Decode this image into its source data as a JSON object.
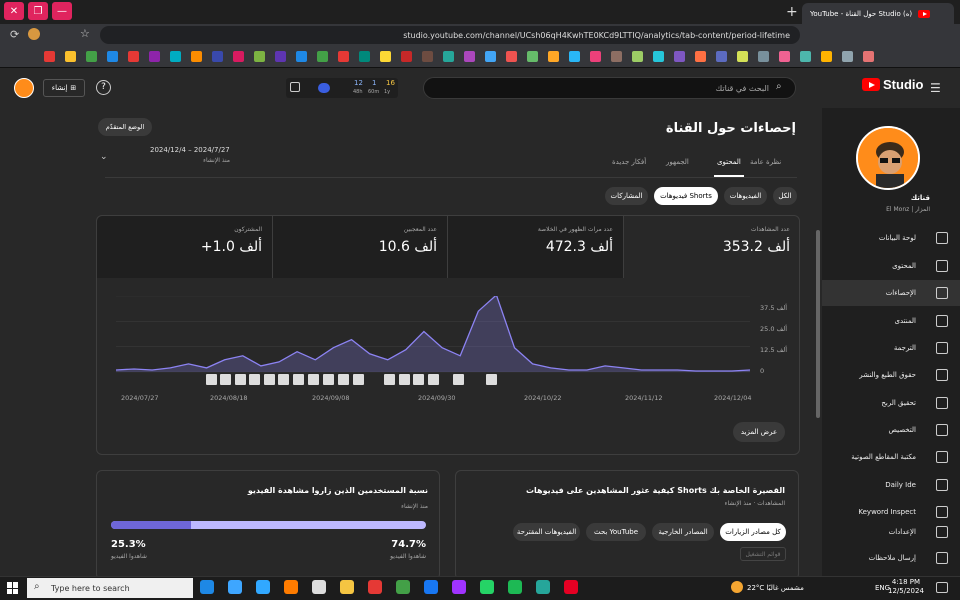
{
  "browser": {
    "tab_title": "(ه) Studio حول القناة - YouTube",
    "new_tab": "+",
    "minimize": "—",
    "restore": "❐",
    "url": "studio.youtube.com/channel/UCsh06qH4KwhTE0KCd9LTTIQ/analytics/tab-content/period-lifetime"
  },
  "header": {
    "search_placeholder": "البحث في قناتك",
    "logo_text": "Studio",
    "create_label": "إنشاء",
    "stats": [
      "12",
      "1",
      "16"
    ],
    "stats_sub": [
      "48h",
      "60m",
      "1y"
    ]
  },
  "sidebar": {
    "channel_name": "قناتك",
    "channel_handle": "El Monz | المزار",
    "items": [
      {
        "label": "لوحة البيانات"
      },
      {
        "label": "المحتوى"
      },
      {
        "label": "الإحصاءات"
      },
      {
        "label": "المنتدى"
      },
      {
        "label": "الترجمة"
      },
      {
        "label": "حقوق الطبع والنشر"
      },
      {
        "label": "تحقيق الربح"
      },
      {
        "label": "التخصيص"
      },
      {
        "label": "مكتبة المقاطع الصوتية"
      },
      {
        "label": "Daily Ide"
      },
      {
        "label": "Keyword Inspect"
      },
      {
        "label": "الإعدادات"
      },
      {
        "label": "إرسال ملاحظات"
      }
    ]
  },
  "main": {
    "title": "إحصاءات حول القناة",
    "advanced": "الوضع المتقدّم",
    "date_range": "2024/12/4 – 2024/7/27",
    "date_sub": "منذ الإنشاء",
    "tabs": [
      "نظرة عامة",
      "المحتوى",
      "الجمهور",
      "أفكار جديدة"
    ],
    "chips": [
      "الكل",
      "الفيديوهات",
      "فيديوهات Shorts",
      "المشاركات"
    ],
    "show_more": "عرض المزيد"
  },
  "stats": [
    {
      "label": "عدد المشاهدات",
      "value": "353.2 ألف"
    },
    {
      "label": "عدد مرات الظهور في الخلاصة",
      "value": "472.3 ألف"
    },
    {
      "label": "عدد المعجبين",
      "value": "10.6 ألف"
    },
    {
      "label": "المشتركون",
      "value": "+1.0 ألف"
    }
  ],
  "chart_data": {
    "type": "line",
    "x": [
      "2024/07/27",
      "2024/08/18",
      "2024/09/08",
      "2024/09/30",
      "2024/10/22",
      "2024/11/12",
      "2024/12/04"
    ],
    "y_ticks": [
      "37.5 ألف",
      "25.0 ألف",
      "12.5 ألف",
      "0"
    ],
    "ylim": [
      0,
      37.5
    ],
    "values": [
      1,
      1.5,
      1,
      2,
      4,
      2,
      6,
      8,
      3,
      5,
      10,
      6,
      12,
      16,
      9,
      6,
      11,
      20,
      12,
      8,
      30,
      38,
      12,
      4,
      2,
      1,
      1,
      3,
      2,
      1,
      1,
      1,
      0.5,
      0.5,
      0.5,
      1
    ],
    "color": "#8c83f3"
  },
  "card_traffic": {
    "title": "كيفية عثور المشاهدين على فيديوهات Shorts القصيرة الخاصة بك",
    "subtitle": "المشاهدات · منذ الإنشاء",
    "chips": [
      "كل مصادر الزيارات",
      "المصادر الخارجية",
      "بحث YouTube",
      "الفيديوهات المقترحة"
    ],
    "bottom": "قوائم التشغيل"
  },
  "card_viewers": {
    "title": "نسبة المستخدمين الذين زاروا مشاهدة الفيديو",
    "subtitle": "منذ الإنشاء",
    "left_value": "25.3%",
    "left_label": "شاهدوا الفيديو",
    "right_value": "74.7%",
    "right_label": "شاهدوا الفيديو",
    "bar_fraction": 0.253
  },
  "taskbar": {
    "search": "Type here to search",
    "weather": "22°C مشمس غالبًا",
    "lang": "ENG",
    "time": "4:18 PM",
    "date": "12/5/2024"
  }
}
